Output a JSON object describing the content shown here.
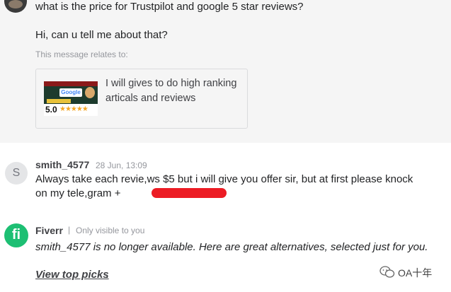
{
  "top_message": {
    "line1": "what is the price for Trustpilot and google 5 star reviews?",
    "line2": "Hi, can u tell me about that?",
    "relates_label": "This message relates to:",
    "gig_card": {
      "title": "I will gives to do high ranking articals and reviews",
      "thumb_logo": "Google",
      "thumb_rating": "5.0",
      "thumb_stars": "★★★★★"
    }
  },
  "reply": {
    "avatar_letter": "S",
    "sender": "smith_4577",
    "timestamp": "28 Jun, 13:09",
    "text": "Always take each revie,ws $5 but i will give you offer sir, but at first please knock on my tele,gram +"
  },
  "system": {
    "logo_text": "fi",
    "sender": "Fiverr",
    "separator": "|",
    "visibility": "Only visible to you",
    "text": "smith_4577 is no longer available. Here are great alternatives, selected just for you.",
    "link": "View top picks",
    "link_suffix": "."
  },
  "watermark": {
    "text": "OA十年"
  }
}
